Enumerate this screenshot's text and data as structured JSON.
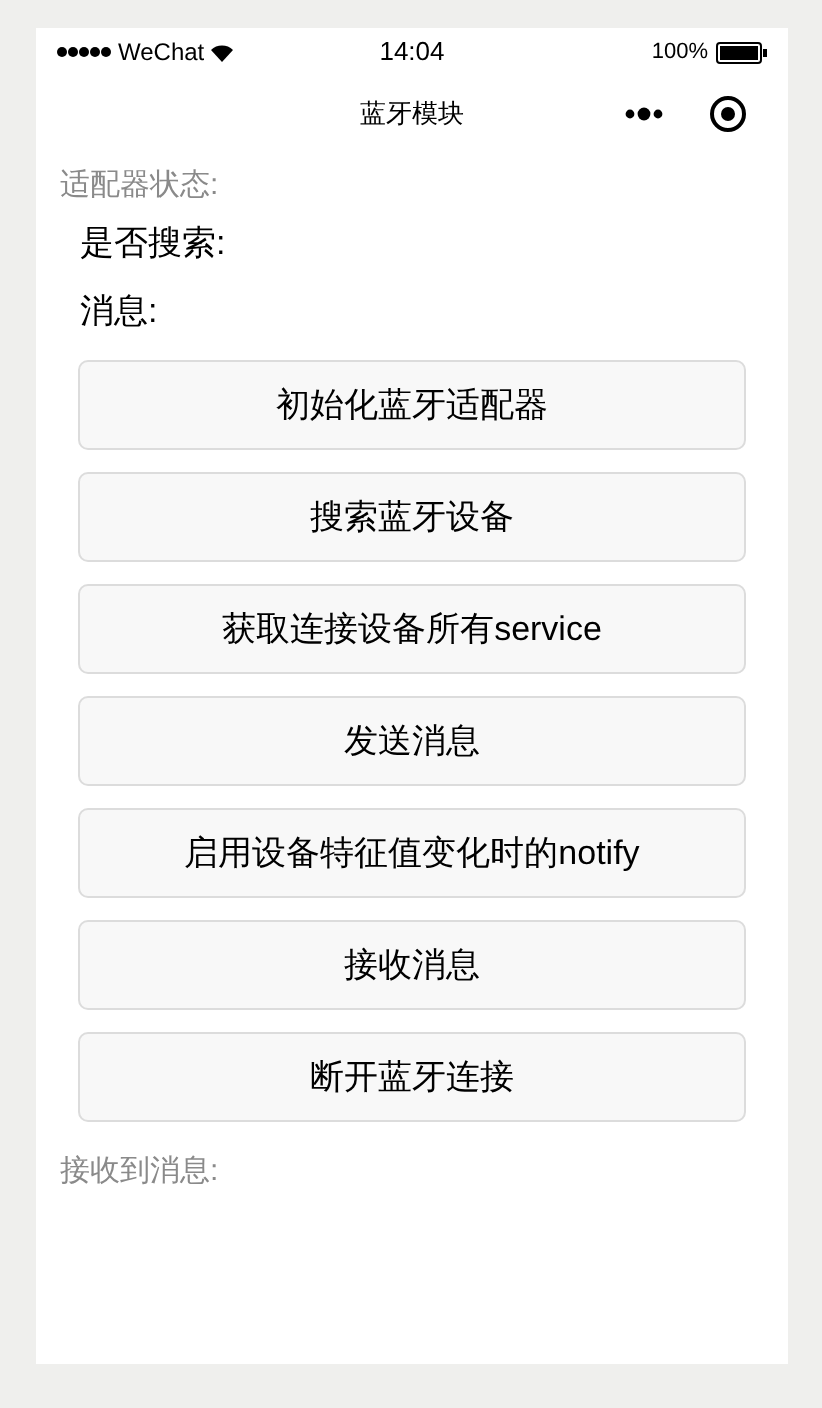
{
  "status_bar": {
    "carrier": "WeChat",
    "time": "14:04",
    "battery": "100%"
  },
  "nav_bar": {
    "title": "蓝牙模块"
  },
  "adapter_status_label": "适配器状态:",
  "fields": [
    {
      "label": "是否搜索:"
    },
    {
      "label": "消息:"
    }
  ],
  "buttons": [
    {
      "label": "初始化蓝牙适配器"
    },
    {
      "label": "搜索蓝牙设备"
    },
    {
      "label": "获取连接设备所有service"
    },
    {
      "label": "发送消息"
    },
    {
      "label": "启用设备特征值变化时的notify"
    },
    {
      "label": "接收消息"
    },
    {
      "label": "断开蓝牙连接"
    }
  ],
  "received_label": "接收到消息:"
}
